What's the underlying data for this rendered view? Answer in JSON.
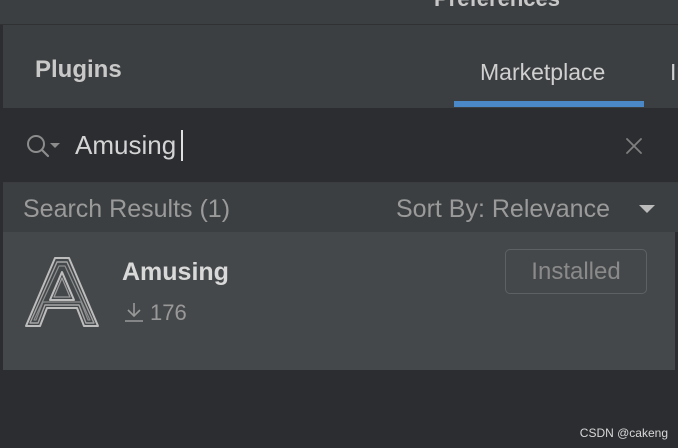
{
  "window": {
    "title": "Preferences"
  },
  "header": {
    "title": "Plugins",
    "tabs": [
      {
        "label": "Marketplace",
        "active": true
      },
      {
        "label": "Installed",
        "active": false
      }
    ],
    "accent_color": "#4a88c7"
  },
  "search": {
    "value": "Amusing",
    "icon": "search-icon",
    "clear_icon": "close-icon"
  },
  "results": {
    "summary": "Search Results (1)",
    "sort_label": "Sort By: Relevance",
    "items": [
      {
        "name": "Amusing",
        "downloads": "176",
        "action_label": "Installed",
        "logo_icon": "amusing-logo"
      }
    ]
  },
  "watermark": "CSDN @cakeng"
}
